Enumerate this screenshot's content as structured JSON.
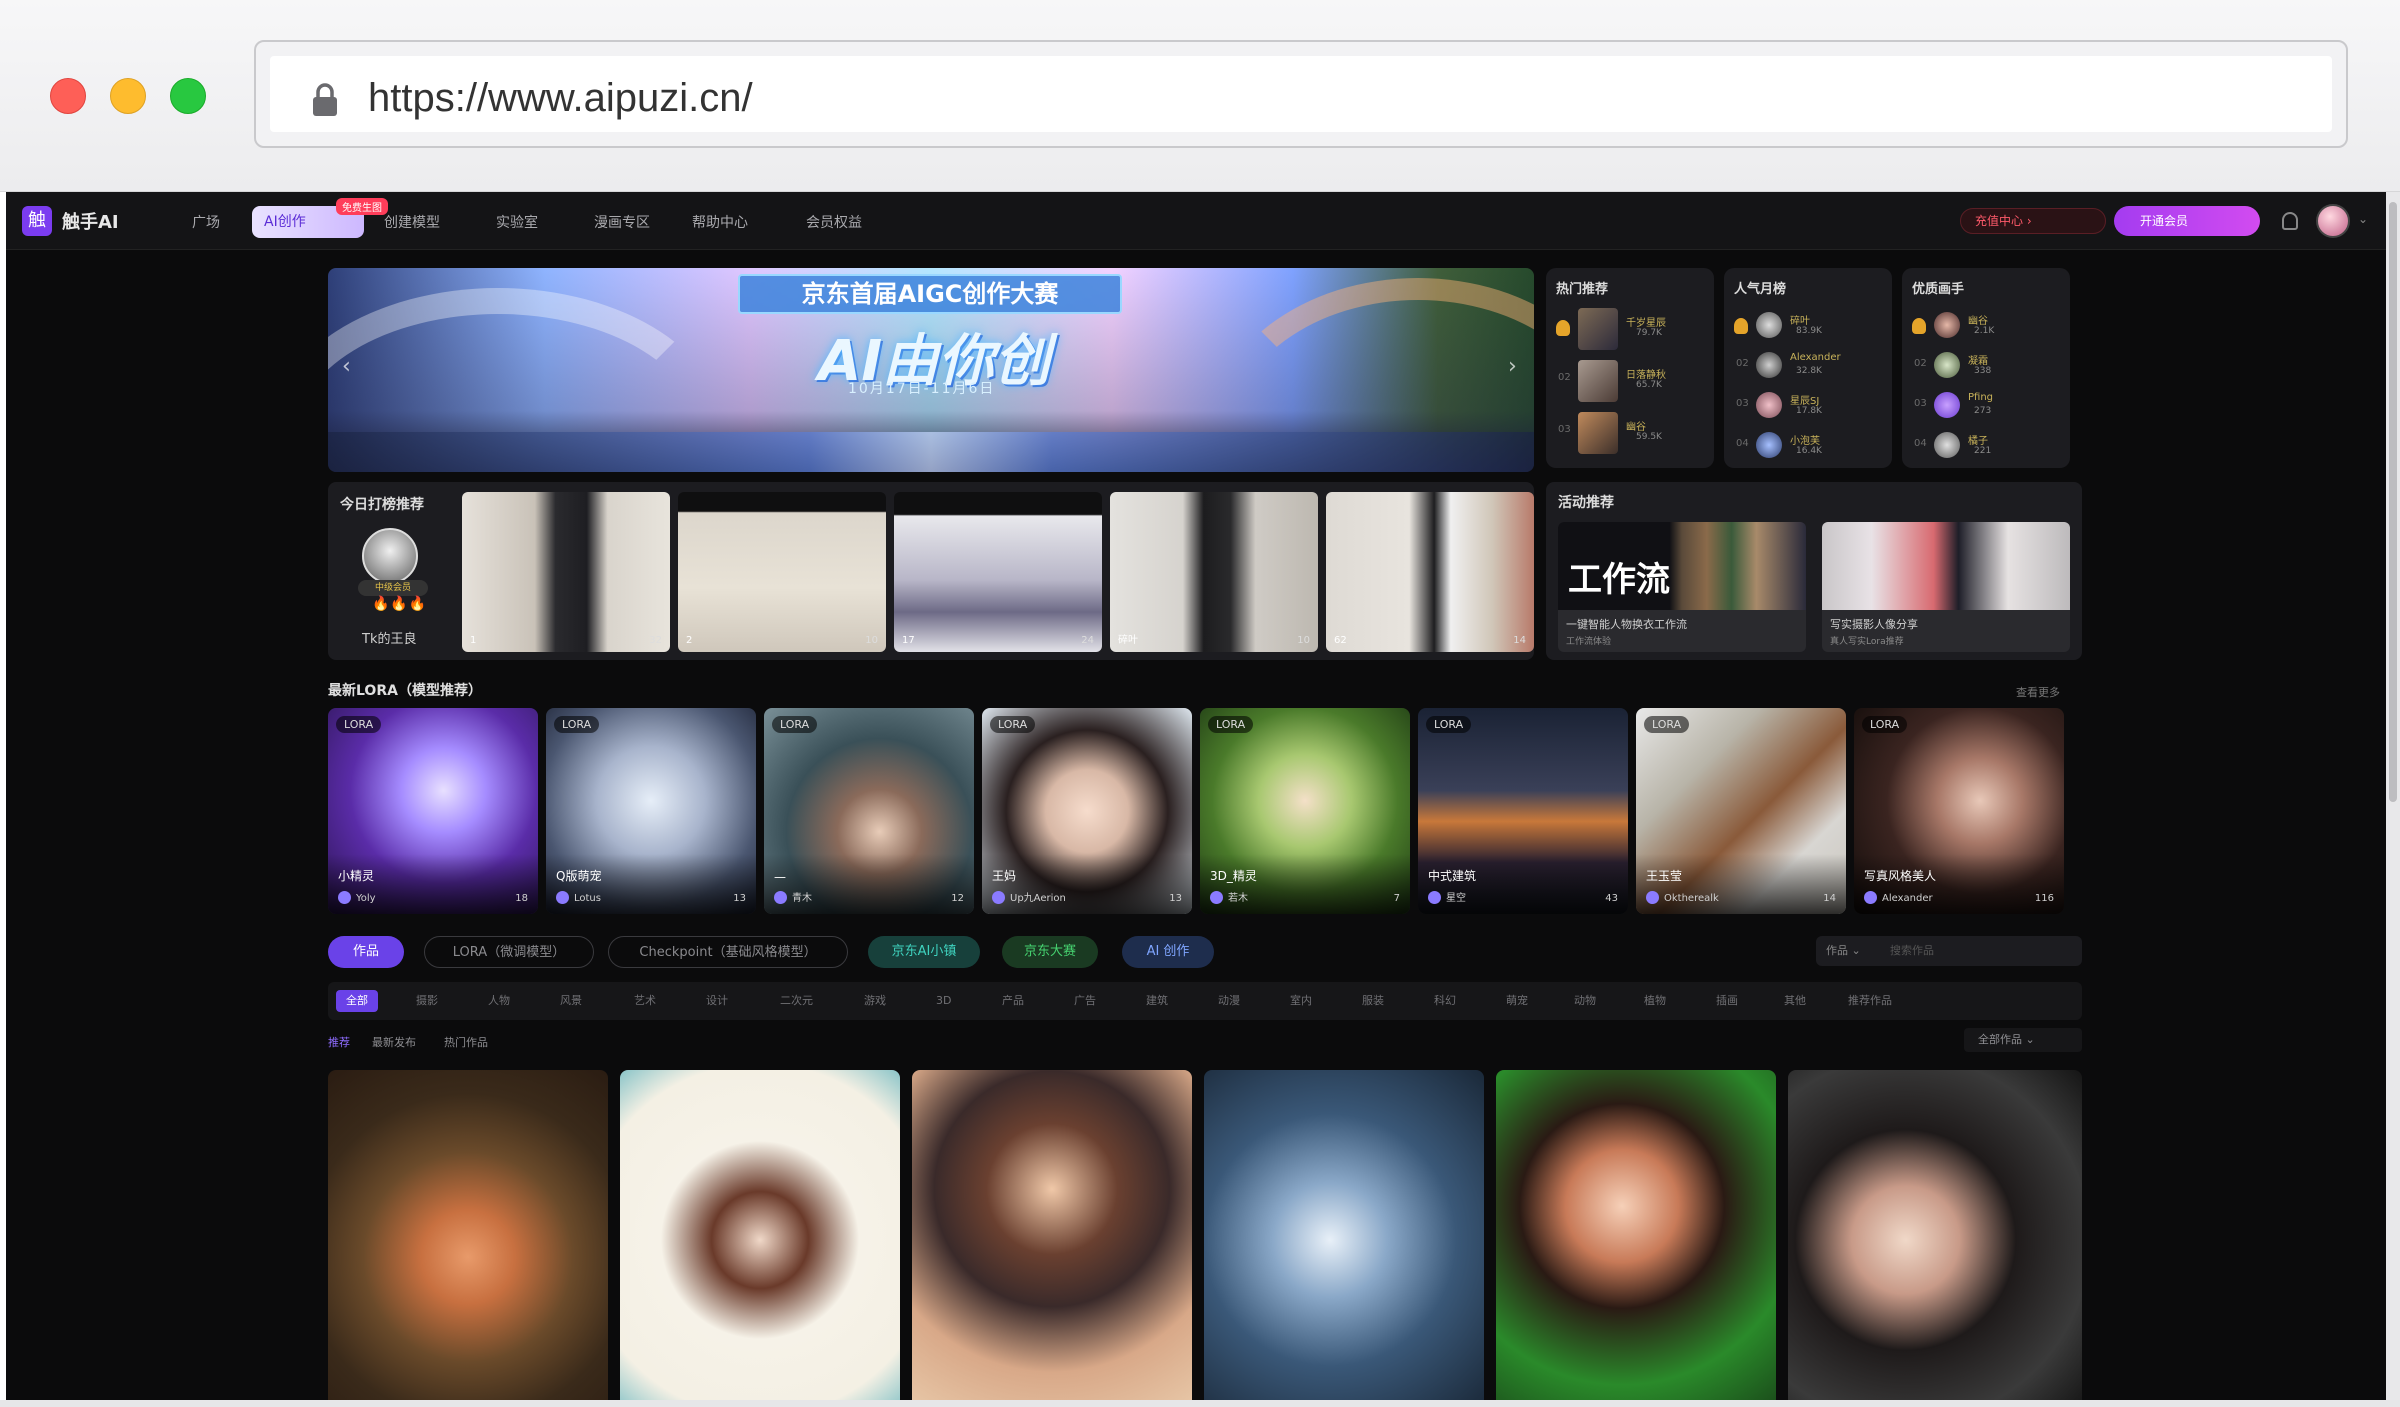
{
  "browser": {
    "url": "https://www.aipuzi.cn/"
  },
  "topnav": {
    "logo": "触手AI",
    "items": [
      "广场",
      "AI创作",
      "创建模型",
      "实验室",
      "漫画专区",
      "帮助中心",
      "会员权益"
    ],
    "pill_label": "AI创作",
    "pill_badge": "免费生图",
    "btn_red": "充值中心",
    "btn_purple": "开通会员"
  },
  "banner": {
    "title": "京东首届AIGC创作大赛",
    "subtitle": "AI由你创",
    "date": "10月17日-11月6日"
  },
  "rank_cards": [
    {
      "title": "热门推荐",
      "rows": [
        {
          "name": "千岁星辰",
          "val": "79.7K"
        },
        {
          "name": "日落静秋",
          "val": "65.7K"
        },
        {
          "name": "幽谷",
          "val": "59.5K"
        }
      ]
    },
    {
      "title": "人气月榜",
      "rows": [
        {
          "name": "碎叶",
          "val": "83.9K"
        },
        {
          "name": "Alexander",
          "val": "32.8K"
        },
        {
          "name": "星辰SJ",
          "val": "17.8K"
        },
        {
          "name": "小泡芙",
          "val": "16.4K"
        }
      ]
    },
    {
      "title": "优质画手",
      "rows": [
        {
          "name": "幽谷",
          "val": "2.1K"
        },
        {
          "name": "凝霜",
          "val": "338"
        },
        {
          "name": "Pfing",
          "val": "273"
        },
        {
          "name": "橘子",
          "val": "221"
        }
      ]
    }
  ],
  "today": {
    "title": "今日打榜推荐",
    "level": "中级会员",
    "fire": "🔥🔥🔥",
    "user": "Tk的王良",
    "thumbs": [
      {
        "cap": "1",
        "cnt": "32"
      },
      {
        "cap": "2",
        "cnt": "10"
      },
      {
        "cap": "17",
        "cnt": "24"
      },
      {
        "cap": "碎叶",
        "cnt": "10"
      },
      {
        "cap": "62",
        "cnt": "14"
      }
    ]
  },
  "recommend": {
    "title": "活动推荐",
    "items": [
      {
        "badge": "工作流",
        "line1": "一键智能人物换衣工作流",
        "line2": "工作流体验"
      },
      {
        "line1": "写实摄影人像分享",
        "line2": "真人写实Lora推荐"
      }
    ]
  },
  "lora": {
    "title": "最新LORA（模型推荐）",
    "more": "查看更多",
    "cards": [
      {
        "name": "小精灵",
        "author": "Yoly",
        "likes": "18"
      },
      {
        "name": "Q版萌宠",
        "author": "Lotus",
        "likes": "13"
      },
      {
        "name": "—",
        "author": "青木",
        "likes": "12"
      },
      {
        "name": "王妈",
        "author": "Up九Aerion",
        "likes": "13"
      },
      {
        "name": "3D_精灵",
        "author": "若木",
        "likes": "7"
      },
      {
        "name": "中式建筑",
        "author": "星空",
        "likes": "43"
      },
      {
        "name": "王玉莹",
        "author": "Oktherealk",
        "likes": "14"
      },
      {
        "name": "写真风格美人",
        "author": "Alexander",
        "likes": "116"
      }
    ]
  },
  "tabs": {
    "works": "作品",
    "lora": "LORA（微调模型）",
    "checkpoint": "Checkpoint（基础风格模型）",
    "teal": "京东AI小镇",
    "green": "京东大赛",
    "blue": "AI 创作",
    "search_select": "作品",
    "search_placeholder": "搜索作品"
  },
  "categories": [
    "全部",
    "摄影",
    "人物",
    "风景",
    "艺术",
    "设计",
    "二次元",
    "游戏",
    "3D",
    "产品",
    "广告",
    "建筑",
    "动漫",
    "室内",
    "服装",
    "科幻",
    "萌宠",
    "动物",
    "植物",
    "插画",
    "其他",
    "推荐作品"
  ],
  "sort": {
    "items": [
      "推荐",
      "最新发布",
      "热门作品"
    ],
    "select": "全部作品"
  },
  "colors": {
    "accent": "#6a42e8",
    "page_bg": "#0b0b0c",
    "card_bg": "#1c1c20"
  }
}
